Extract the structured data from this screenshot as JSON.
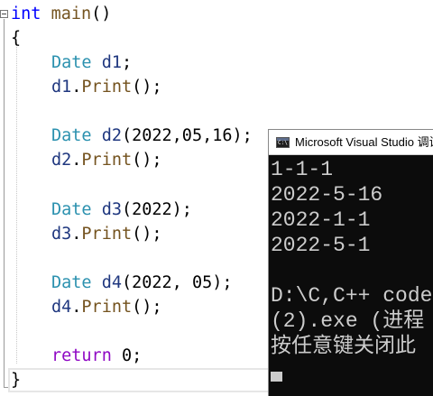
{
  "editor": {
    "lines": {
      "l1": {
        "kw": "int",
        "fn": "main",
        "rest": "()"
      },
      "l2": {
        "text": "{"
      },
      "l3": {
        "type": "Date",
        "var": "d1",
        "rest": ";"
      },
      "l4": {
        "var": "d1",
        "dot": ".",
        "fn": "Print",
        "rest": "();"
      },
      "l5": {
        "type": "Date",
        "var": "d2",
        "rest": "(2022,05,16);"
      },
      "l6": {
        "var": "d2",
        "dot": ".",
        "fn": "Print",
        "rest": "();"
      },
      "l7": {
        "type": "Date",
        "var": "d3",
        "rest": "(2022);"
      },
      "l8": {
        "var": "d3",
        "dot": ".",
        "fn": "Print",
        "rest": "();"
      },
      "l9": {
        "type": "Date",
        "var": "d4",
        "rest": "(2022, 05);"
      },
      "l10": {
        "var": "d4",
        "dot": ".",
        "fn": "Print",
        "rest": "();"
      },
      "l11": {
        "kw": "return",
        "rest": " 0;"
      },
      "l12": {
        "text": "}"
      }
    }
  },
  "console": {
    "title": "Microsoft Visual Studio 调试",
    "output": {
      "line1": "1-1-1",
      "line2": "2022-5-16",
      "line3": "2022-1-1",
      "line4": "2022-5-1",
      "line5": "D:\\C,C++ code",
      "line6": "(2).exe (进程",
      "line7": "按任意键关闭此"
    }
  }
}
